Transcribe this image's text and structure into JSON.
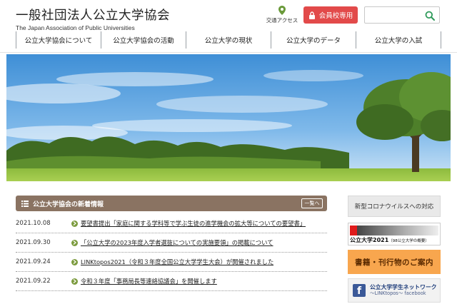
{
  "header": {
    "title": "一般社団法人公立大学協会",
    "subtitle": "The Japan Association of Public Universities",
    "access_label": "交通アクセス",
    "members_label": "会員校専用",
    "search_placeholder": ""
  },
  "nav": {
    "items": [
      {
        "label": "公立大学協会について"
      },
      {
        "label": "公立大学協会の活動"
      },
      {
        "label": "公立大学の現状"
      },
      {
        "label": "公立大学のデータ"
      },
      {
        "label": "公立大学の入試"
      }
    ]
  },
  "news": {
    "title": "公立大学協会の新着情報",
    "more_label": "一覧へ",
    "items": [
      {
        "date": "2021.10.08",
        "text": "要望書提出「家庭に関する学科等で学ぶ生徒の進学機会の拡大等についての要望書」"
      },
      {
        "date": "2021.09.30",
        "text": "「公立大学の2023年度入学者選抜についての実施要領」の掲載について"
      },
      {
        "date": "2021.09.24",
        "text": "LINKtopos2021（令和３年度全国公立大学学生大会）が開催されました"
      },
      {
        "date": "2021.09.22",
        "text": "令和３年度「事務局長等連絡協議会」を開催します"
      }
    ]
  },
  "sidebar": {
    "corona_label": "新型コロナウイルスへの対応",
    "banner2021_main": "公立大学2021",
    "banner2021_sub": "（98公立大学の概要）",
    "publications_label": "書籍・刊行物のご案内",
    "fb_line1": "公立大学学生ネットワーク",
    "fb_line2": "〜LINKtopos〜 facebook"
  },
  "colors": {
    "members_button": "#e24a4a",
    "news_header": "#8a7362",
    "news_arrow": "#7c9b3e",
    "publications_banner": "#f8a64e",
    "facebook": "#3b5998",
    "accent_green": "#2e9a5a"
  },
  "icons": {
    "access": "map-pin-icon",
    "members": "lock-icon",
    "search": "search-icon",
    "news": "list-icon",
    "news_item": "arrow-right-icon",
    "facebook": "facebook-icon"
  }
}
